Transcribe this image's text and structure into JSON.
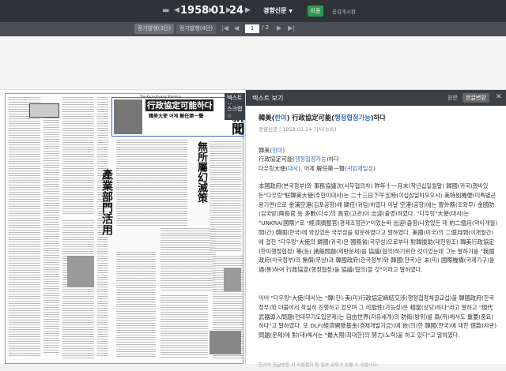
{
  "topbar": {
    "year": "1958",
    "month": "01",
    "day": "24",
    "newspaper": "경향신문",
    "go_button": "이동",
    "notice_link": "공감게시판"
  },
  "secondbar": {
    "tab1": "정기발행(3단)",
    "tab2": "정기발행(4단)",
    "page_current": "1",
    "page_total": "/ 2"
  },
  "viewer": {
    "masthead_small": "The Kyunghyang Shinmun",
    "masthead_big": "新聞",
    "headline_main": "行政協定可能하다",
    "headline_sub": "韓美大使  어제 解任第一聲",
    "headline_side": "無所屬幻滅策",
    "headline_industry": "產業部門活用",
    "float_text": "텍스트 보",
    "float_script": "스크랩 ☆"
  },
  "text_panel": {
    "title": "텍스트 보기",
    "convert_label": "원문",
    "hangul_button": "한글변환",
    "close_icon": "✕",
    "article_title_pre": "韓美(",
    "article_title_hl": "한미",
    "article_title_mid": ") 行政協定可能(",
    "article_title_hl2": "행정협정가능",
    "article_title_post": ")하다",
    "byline": "경향신문 | 1958.01.24 기사(뉴스)",
    "sub1_pre": "韓美(",
    "sub1_hl": "한미",
    "sub1_post": ")",
    "sub2_pre": "行政協定可能(",
    "sub2_hl": "행정협정가능",
    "sub2_post": ")하다",
    "sub3_pre": "다우링大使(",
    "sub3_hl": "대사",
    "sub3_mid": "), 어제 解任第一聲(",
    "sub3_hl2": "귀임제일성",
    "sub3_post": ")",
    "para1": " 本國政府(본국정부)와 事務協議次(사무협의차) 昨年十一月末(작년십일월말) 歸國(귀국)했바있든\"다우링\"駐韓美大使(주한미대사)는 二十三日下午五時(이십삼일하오오시) 美特別機便(미특별군용기편)으로 金浦空港(김포공항)에 歸任(귀임)하였다 이날 空港(공항)에는 曺外務(조외무) 金國防(김국방)兩長官 등 多數(다수)의 高官(고관)이 出迎(출영)하였다. \"다우링\"大使(대사)는 \"UNKRA(國際)\"로 \"經濟調整官(경제조정관)\"이었는바 出迎(출영)나왔었든 데 約二個月(약이개월)間(간) 韓國(한국)에 와있었든 국무성을 방문하였다고 말하였다. 美國(미국)의 二個月間(이개월간)에 걸친 \"다우링\"大使의 歸國(귀국)은 國務省(국무성)으로부터 對韓援助(대한원조) 韓美行政協定(한미행정협정) 等(등) 諸般問題(제반문제)를 協議(협의)하기위한 것이었는데 그는 말하기를 \"我國政府(아국정부)의 無償(무상)과 韓國政府(한국정부)와 韓國(한국)은 未(미) 國際機構(국제기구)를 通(통)하여 行政協定(행정협정)을 協議(협의)할 것\"이라고 말하였다.",
    "para2": " 이어 \"다우링\"大使(대사)는 \"韓(한)·美(미)行政協定締結交涉(행정협정체결교섭)을 韓國政府(한국정부)와 더불어서 착실히 진행하고 있으며 그 可能性(가능성)은 相當(상당)하다\"라고 말하고 \"現代武器導入問題(현대무기도입문제)는 自由世界(자유세계)의 防衛(방위)를 爲(위)해서도 重要(중요)하다\"고 말하였다. 또 DLF(經濟開發基金(경제개발기금))에 依(의)한 韓國(한국)에 대한 借款(차관) 問題(문제)에 對(대)해서는 \"最大限(최대한)의 努力(노력)을 하고 있다\"고 말하였다.",
    "footer": "한자의 한글변환 시 무음합자 등 일부 오류가 있을 수 있습니다."
  }
}
